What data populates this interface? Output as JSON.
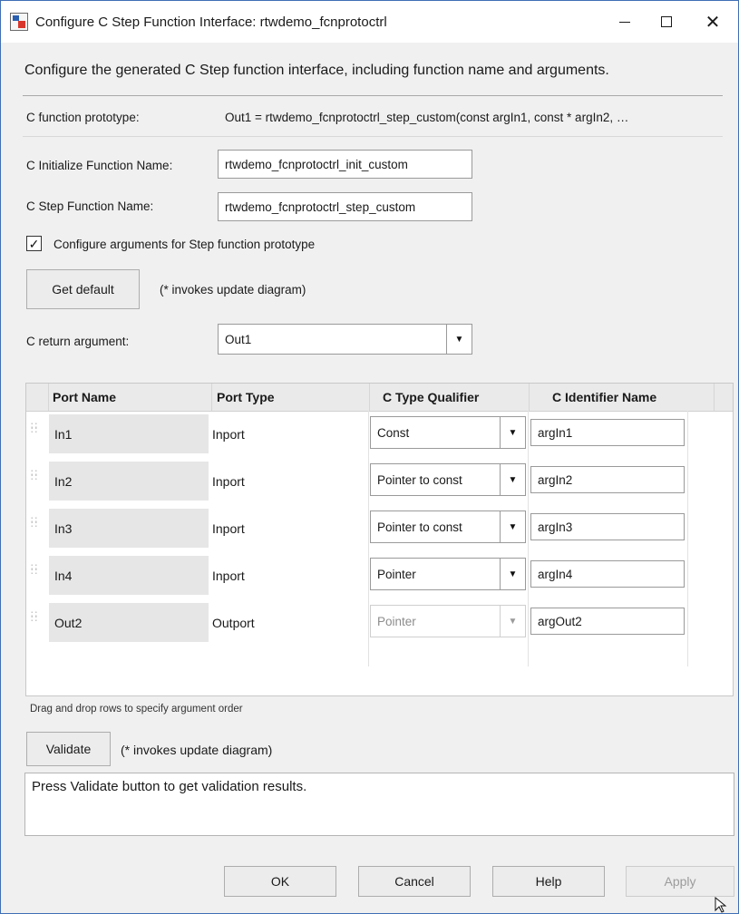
{
  "window": {
    "title": "Configure C Step Function Interface: rtwdemo_fcnprotoctrl",
    "minimize_label": "",
    "close_glyph": "✕"
  },
  "description": "Configure the generated C Step function interface, including function name and arguments.",
  "prototype": {
    "label": "C function prototype:",
    "value": "Out1 = rtwdemo_fcnprotoctrl_step_custom(const argIn1, const * argIn2, …"
  },
  "init_function": {
    "label": "C Initialize Function Name:",
    "value": "rtwdemo_fcnprotoctrl_init_custom"
  },
  "step_function": {
    "label": "C Step Function Name:",
    "value": "rtwdemo_fcnprotoctrl_step_custom"
  },
  "configure_args": {
    "label": "Configure arguments for Step function prototype",
    "checked": true,
    "check_glyph": "✓"
  },
  "get_default": {
    "label": "Get default",
    "note": "(* invokes update diagram)"
  },
  "return_arg": {
    "label": "C return argument:",
    "value": "Out1",
    "arrow_glyph": "▼"
  },
  "table": {
    "headers": [
      "Port Name",
      "Port Type",
      "C Type Qualifier",
      "C Identifier Name"
    ],
    "rows": [
      {
        "port_name": "In1",
        "port_type": "Inport",
        "qualifier": "Const",
        "identifier": "argIn1",
        "enabled": true
      },
      {
        "port_name": "In2",
        "port_type": "Inport",
        "qualifier": "Pointer to const",
        "identifier": "argIn2",
        "enabled": true
      },
      {
        "port_name": "In3",
        "port_type": "Inport",
        "qualifier": "Pointer to const",
        "identifier": "argIn3",
        "enabled": true
      },
      {
        "port_name": "In4",
        "port_type": "Inport",
        "qualifier": "Pointer",
        "identifier": "argIn4",
        "enabled": true
      },
      {
        "port_name": "Out2",
        "port_type": "Outport",
        "qualifier": "Pointer",
        "identifier": "argOut2",
        "enabled": false
      }
    ]
  },
  "drag_note": "Drag and drop rows to specify argument order",
  "validate": {
    "label": "Validate",
    "note": "(* invokes update diagram)"
  },
  "results_text": "Press Validate button to get validation results.",
  "buttons": {
    "ok": "OK",
    "cancel": "Cancel",
    "help": "Help",
    "apply": "Apply"
  },
  "icons": {
    "app": "simulink-block-icon",
    "grip": "drag-grip-icon",
    "dropdown": "chevron-down-icon",
    "cursor": "mouse-cursor-icon"
  },
  "colors": {
    "window_border": "#3f6fb5",
    "dialog_bg": "#f0f0f0",
    "disabled_text": "#9b9b9b"
  }
}
